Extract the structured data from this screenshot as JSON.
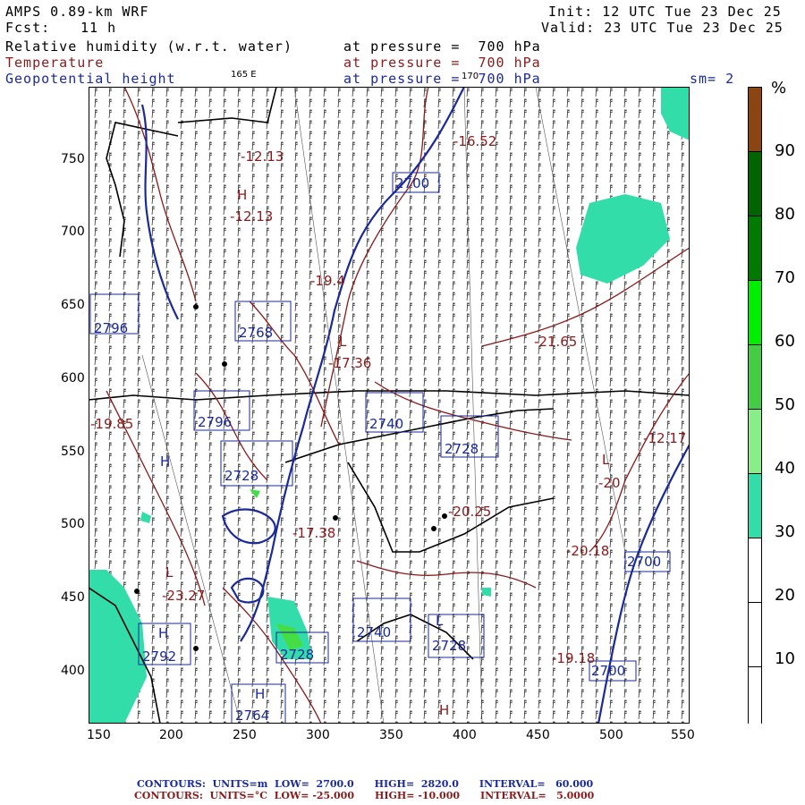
{
  "header": {
    "model": "AMPS 0.89-km WRF",
    "fcst_label": "Fcst:",
    "fcst_value": "11 h",
    "init": "Init: 12 UTC Tue 23 Dec 25",
    "valid": "Valid: 23 UTC Tue 23 Dec 25"
  },
  "fields": [
    {
      "name": "Relative humidity (w.r.t. water)",
      "level": "at pressure =  700 hPa",
      "color": "#000000"
    },
    {
      "name": "Temperature",
      "level": "at pressure =  700 hPa",
      "color": "#8b1a1a"
    },
    {
      "name": "Geopotential height",
      "level": "at pressure =  700 hPa",
      "color": "#1a2a9a"
    }
  ],
  "smoothing": "sm= 2",
  "map_marks": {
    "lon165": "165 E",
    "lon170": "170"
  },
  "axes": {
    "x_ticks": [
      "150",
      "200",
      "250",
      "300",
      "350",
      "400",
      "450",
      "500",
      "550"
    ],
    "y_ticks": [
      "750",
      "700",
      "650",
      "600",
      "550",
      "500",
      "450",
      "400"
    ]
  },
  "colorbar": {
    "unit": "%",
    "labels": [
      "90",
      "80",
      "70",
      "60",
      "50",
      "40",
      "30",
      "20",
      "10"
    ],
    "colors": [
      "#8b4513",
      "#006400",
      "#008000",
      "#00ee00",
      "#44dd44",
      "#88ee88",
      "#33ddaa",
      "#ffffff",
      "#ffffff",
      "#ffffff"
    ]
  },
  "contour_labels": {
    "height": [
      "2700",
      "2796",
      "2768",
      "2796",
      "2740",
      "2728",
      "2728",
      "2700",
      "2792",
      "2728",
      "2740",
      "2728",
      "2700",
      "2764"
    ],
    "temp": [
      "-12.13",
      "-12.13",
      "-16.52",
      "-21.65",
      "-17.36",
      "-19.4",
      "-19.85",
      "-20.25",
      "-20.18",
      "-19.18",
      "-17.38",
      "-23.27",
      "-20",
      "-12.17"
    ],
    "extrema": [
      "H",
      "H",
      "L",
      "L",
      "H",
      "L",
      "H",
      "L",
      "H"
    ]
  },
  "footer": {
    "line1": "CONTOURS:  UNITS=m  LOW=  2700.0      HIGH=  2820.0      INTERVAL=   60.000",
    "line2": "CONTOURS:  UNITS=°C  LOW= -25.000      HIGH= -10.000      INTERVAL=   5.0000",
    "color1": "#1a2a9a",
    "color2": "#8b1a1a"
  }
}
